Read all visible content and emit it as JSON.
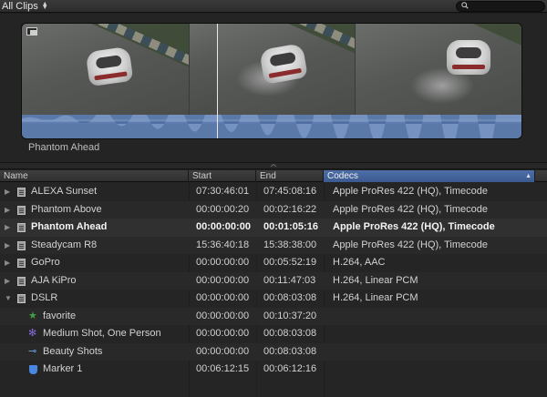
{
  "browser": {
    "filter_label": "All Clips",
    "search_placeholder": ""
  },
  "viewer": {
    "clip_name": "Phantom Ahead"
  },
  "list": {
    "columns": [
      "Name",
      "Start",
      "End",
      "Codecs"
    ],
    "sorted_column": "Codecs",
    "rows": [
      {
        "name": "ALEXA Sunset",
        "start": "07:30:46:01",
        "end": "07:45:08:16",
        "codec": "Apple ProRes 422 (HQ), Timecode",
        "kind": "clip",
        "expanded": false
      },
      {
        "name": "Phantom Above",
        "start": "00:00:00:20",
        "end": "00:02:16:22",
        "codec": "Apple ProRes 422 (HQ), Timecode",
        "kind": "clip",
        "expanded": false
      },
      {
        "name": "Phantom Ahead",
        "start": "00:00:00:00",
        "end": "00:01:05:16",
        "codec": "Apple ProRes 422 (HQ), Timecode",
        "kind": "clip",
        "expanded": false,
        "selected": true
      },
      {
        "name": "Steadycam R8",
        "start": "15:36:40:18",
        "end": "15:38:38:00",
        "codec": "Apple ProRes 422 (HQ), Timecode",
        "kind": "clip",
        "expanded": false
      },
      {
        "name": "GoPro",
        "start": "00:00:00:00",
        "end": "00:05:52:19",
        "codec": "H.264, AAC",
        "kind": "clip",
        "expanded": false
      },
      {
        "name": "AJA KiPro",
        "start": "00:00:00:00",
        "end": "00:11:47:03",
        "codec": "H.264, Linear PCM",
        "kind": "clip",
        "expanded": false
      },
      {
        "name": "DSLR",
        "start": "00:00:00:00",
        "end": "00:08:03:08",
        "codec": "H.264, Linear PCM",
        "kind": "clip",
        "expanded": true
      },
      {
        "name": "favorite",
        "start": "00:00:00:00",
        "end": "00:10:37:20",
        "codec": "",
        "kind": "favorite"
      },
      {
        "name": "Medium Shot, One Person",
        "start": "00:00:00:00",
        "end": "00:08:03:08",
        "codec": "",
        "kind": "analysis"
      },
      {
        "name": "Beauty Shots",
        "start": "00:00:00:00",
        "end": "00:08:03:08",
        "codec": "",
        "kind": "keyword"
      },
      {
        "name": "Marker 1",
        "start": "00:06:12:15",
        "end": "00:06:12:16",
        "codec": "",
        "kind": "marker"
      }
    ]
  },
  "colors": {
    "accent": "#4a6ea8",
    "waveform": "#5a78a8",
    "favorite": "#3fa043",
    "marker": "#4a87e0"
  }
}
